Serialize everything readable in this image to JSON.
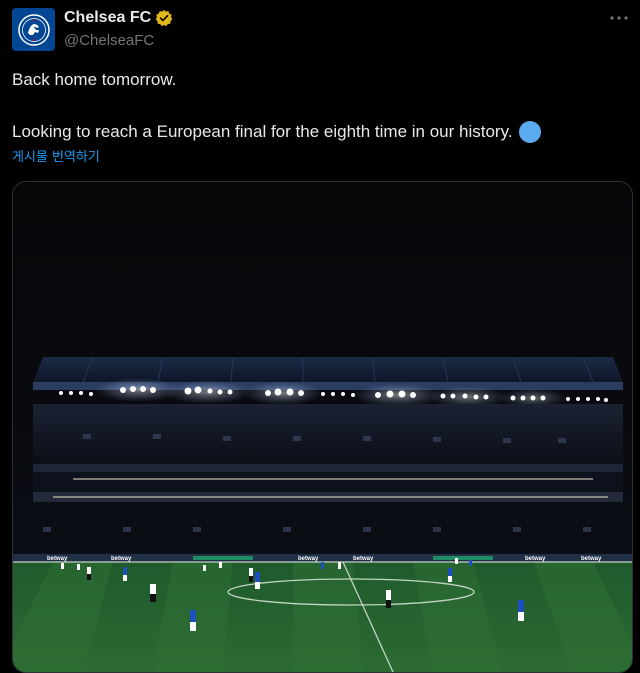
{
  "account": {
    "display_name": "Chelsea FC",
    "handle": "@ChelseaFC",
    "verified_icon": "verified-badge-gold-icon",
    "avatar_icon": "chelsea-crest-icon"
  },
  "tweet": {
    "line1": "Back home tomorrow.",
    "line2": "Looking to reach a European final for the eighth time in our history.",
    "emoji": "blue-circle-emoji",
    "translate_label": "게시물 번역하기"
  },
  "media": {
    "description_icon": "stadium-photo",
    "sponsor_text": "betway"
  },
  "colors": {
    "background": "#000000",
    "text": "#e7e9ea",
    "secondary": "#71767b",
    "link": "#1d9bf0",
    "brand": "#034694",
    "verified": "#e2b719",
    "emoji_blue": "#5aaaf0"
  }
}
